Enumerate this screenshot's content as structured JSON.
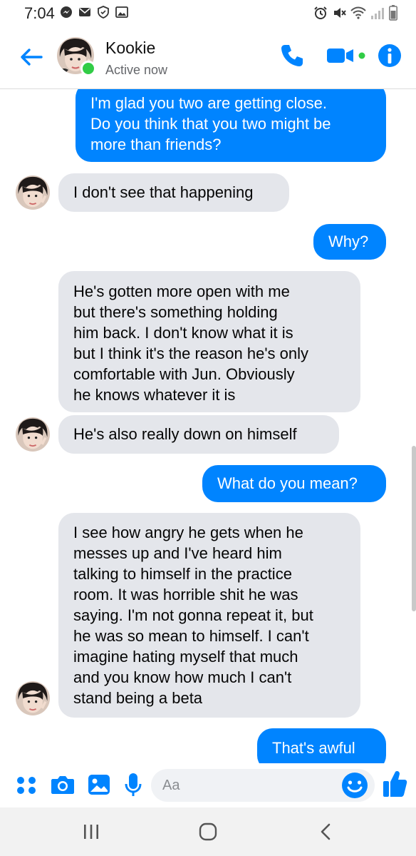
{
  "status_bar": {
    "time": "7:04",
    "left_icons": [
      "messenger-icon",
      "mail-icon",
      "shield-icon",
      "image-icon"
    ],
    "right_icons": [
      "alarm-icon",
      "mute-icon",
      "wifi-icon",
      "signal-icon",
      "battery-icon"
    ]
  },
  "header": {
    "contact_name": "Kookie",
    "contact_status": "Active now",
    "accent_color": "#0084ff",
    "active_color": "#31cc46",
    "icons": [
      "back-arrow-icon",
      "phone-icon",
      "video-icon",
      "info-icon"
    ]
  },
  "messages": [
    {
      "from": "me",
      "text": "I'm glad you two are getting close.\nDo you think that you two might be\nmore than friends?"
    },
    {
      "from": "them",
      "text": "I don't see that happening"
    },
    {
      "from": "me",
      "text": "Why?"
    },
    {
      "from": "them",
      "text": "He's gotten more open with me\nbut there's something holding\nhim back. I don't know what it is\nbut I think it's the reason he's only\ncomfortable with Jun. Obviously\nhe knows whatever it is"
    },
    {
      "from": "them",
      "text": "He's also really down on himself"
    },
    {
      "from": "me",
      "text": "What do you mean?"
    },
    {
      "from": "them",
      "text": "I see how angry he gets when he\nmesses up and I've heard him\ntalking to himself in the practice\nroom. It was horrible shit he was\nsaying. I'm not gonna repeat it, but\nhe was so mean to himself. I can't\nimagine hating myself that much\nand you know how much I can't\nstand being a beta"
    },
    {
      "from": "me",
      "text": "That's awful"
    }
  ],
  "composer": {
    "placeholder": "Aa",
    "icons": [
      "menu-dots-icon",
      "camera-icon",
      "gallery-icon",
      "microphone-icon",
      "emoji-icon",
      "thumbs-up-icon"
    ]
  },
  "navigation": {
    "icons": [
      "recent-apps-icon",
      "home-icon",
      "back-icon"
    ]
  }
}
